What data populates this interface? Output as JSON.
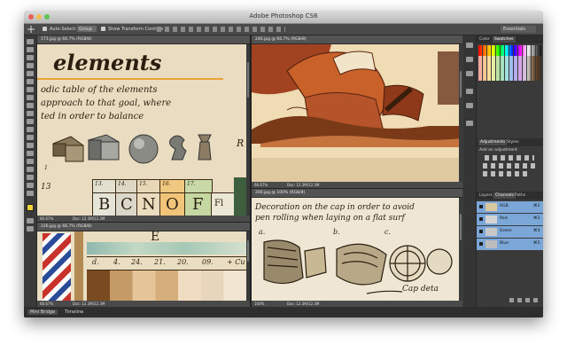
{
  "window": {
    "title": "Adobe Photoshop CS6",
    "traffic_lights": [
      "#ec5f56",
      "#f4be4f",
      "#5fc453"
    ]
  },
  "options_bar": {
    "auto_select_label": "Auto-Select:",
    "auto_select_value": "Group",
    "show_transform_label": "Show Transform Controls",
    "workspace": "Essentials"
  },
  "documents": [
    {
      "tab": "173.jpg @ 66.7% (RGB/8)",
      "status_zoom": "66.67%",
      "status_doc": "Doc: 12.3M/12.3M",
      "canvas_text": {
        "title": "elements",
        "line1": "odic table of the elements",
        "line2": "approach to that goal, where",
        "line3": "ted in order to balance",
        "numbers": [
          "13.",
          "14.",
          "15.",
          "16.",
          "17."
        ],
        "letters": [
          "B",
          "C",
          "N",
          "O",
          "F"
        ],
        "extra_letter": "Fl",
        "side_letter": "R",
        "small_numbers": [
          "1",
          "13"
        ]
      }
    },
    {
      "tab": "246.jpg @ 66.7% (RGB/8)",
      "status_zoom": "66.67%",
      "status_doc": "Doc: 12.3M/12.3M"
    },
    {
      "tab": "226.jpg @ 66.7% (RGB/8)",
      "status_zoom": "66.67%",
      "status_doc": "Doc: 12.3M/12.3M",
      "canvas_text": {
        "letter": "E",
        "cells": [
          "d.",
          "4.",
          "24.",
          "21.",
          "20.",
          "09.",
          "+ Cu"
        ]
      }
    },
    {
      "tab": "200.jpg @ 100% (RGB/8)",
      "status_zoom": "100%",
      "status_doc": "Doc: 12.3M/12.3M",
      "canvas_text": {
        "line1": "Decoration on the cap in order to avoid",
        "line2": "pen rolling when laying on a flat surf",
        "labels": [
          "a.",
          "b.",
          "c."
        ],
        "caption": "Cap deta"
      }
    }
  ],
  "panels": {
    "color_tabs": [
      "Color",
      "Swatches"
    ],
    "adjustments_tabs": [
      "Adjustments",
      "Styles"
    ],
    "adjustments_title": "Add an adjustment",
    "channels_tabs": [
      "Layers",
      "Channels",
      "Paths"
    ],
    "channels": [
      {
        "name": "RGB",
        "shortcut": "⌘2"
      },
      {
        "name": "Red",
        "shortcut": "⌘3"
      },
      {
        "name": "Green",
        "shortcut": "⌘4"
      },
      {
        "name": "Blue",
        "shortcut": "⌘5"
      }
    ]
  },
  "bottom_tabs": [
    "Mini Bridge",
    "Timeline"
  ],
  "colors": {
    "foreground": "#f2d33a",
    "background": "#ffffff",
    "accent": "#7aa7d8"
  }
}
